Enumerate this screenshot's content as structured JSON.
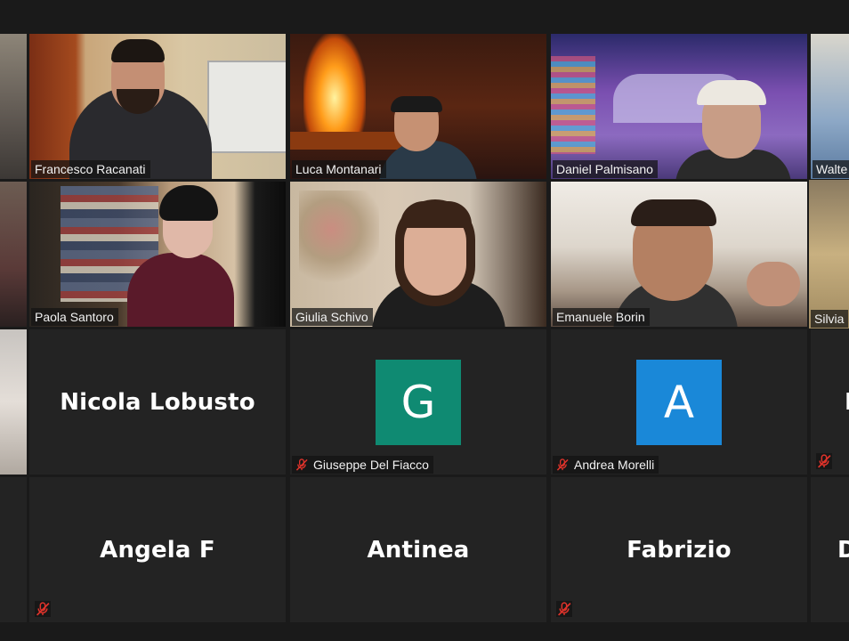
{
  "participants": [
    {
      "name": "Francesco Racanati"
    },
    {
      "name": "Luca Montanari"
    },
    {
      "name": "Daniel Palmisano"
    },
    {
      "name": "Walte"
    },
    {
      "name": "Paola Santoro"
    },
    {
      "name": "Giulia Schivo"
    },
    {
      "name": "Emanuele Borin"
    },
    {
      "name": "Silvia"
    },
    {
      "name": "Nicola Lobusto"
    },
    {
      "name": "Giuseppe Del Fiacco",
      "avatar_letter": "G"
    },
    {
      "name": "Andrea Morelli",
      "avatar_letter": "A"
    },
    {
      "name": "N"
    },
    {
      "name": "Angela F"
    },
    {
      "name": "Antinea"
    },
    {
      "name": "Fabrizio"
    },
    {
      "name": "D"
    }
  ],
  "colors": {
    "active_speaker_border": "#e6dc6a",
    "avatar_green": "#0f8a72",
    "avatar_blue": "#1a88d8",
    "mute_red": "#e0332b"
  }
}
